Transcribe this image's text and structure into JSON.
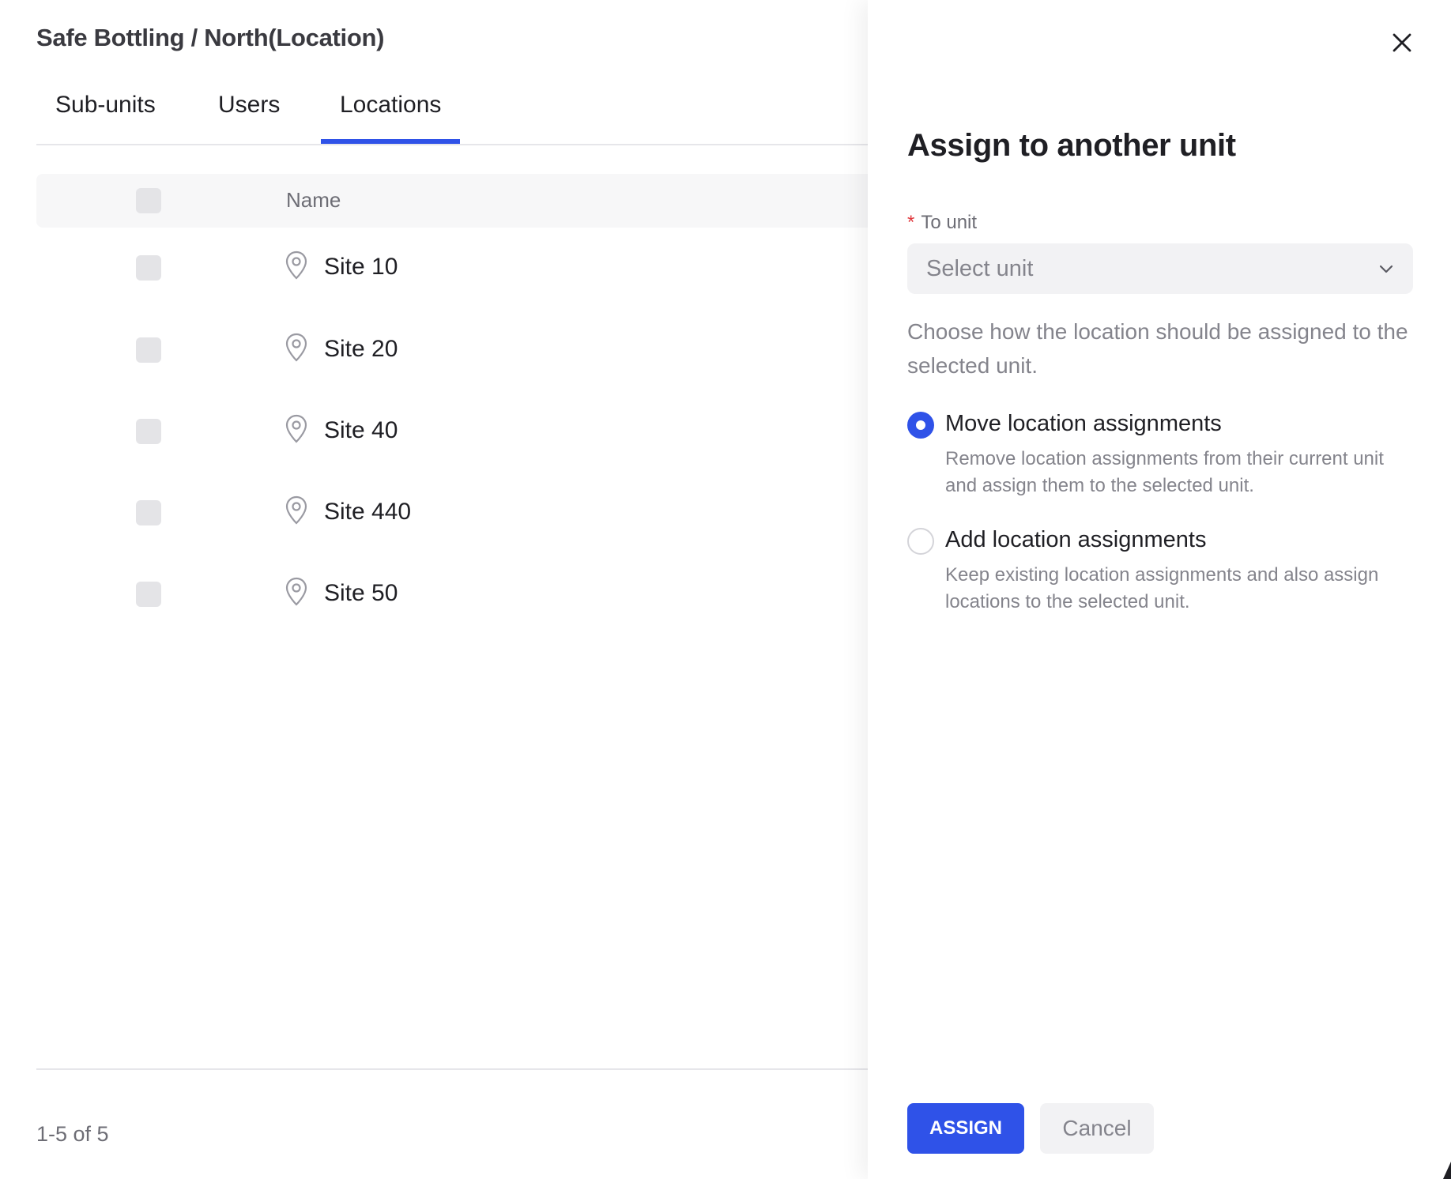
{
  "page": {
    "breadcrumb": "Safe Bottling / North(Location)",
    "tabs": [
      {
        "label": "Sub-units",
        "active": false
      },
      {
        "label": "Users",
        "active": false
      },
      {
        "label": "Locations",
        "active": true
      }
    ],
    "table": {
      "columns": [
        "Name"
      ],
      "rows": [
        {
          "name": "Site 10",
          "icon": "map-pin-icon"
        },
        {
          "name": "Site 20",
          "icon": "map-pin-icon"
        },
        {
          "name": "Site 40",
          "icon": "map-pin-icon"
        },
        {
          "name": "Site 440",
          "icon": "map-pin-icon"
        },
        {
          "name": "Site 50",
          "icon": "map-pin-icon"
        }
      ]
    },
    "pagination": "1-5 of 5"
  },
  "drawer": {
    "title": "Assign to another unit",
    "close_icon": "close-icon",
    "field": {
      "required_marker": "*",
      "label": "To unit",
      "placeholder": "Select unit",
      "icon": "chevron-down-icon"
    },
    "helper": "Choose how the location should be assigned to the selected unit.",
    "options": [
      {
        "title": "Move location assignments",
        "description": "Remove location assignments from their current unit and assign them to the selected unit.",
        "selected": true
      },
      {
        "title": "Add location assignments",
        "description": "Keep existing location assignments and also assign locations to the selected unit.",
        "selected": false
      }
    ],
    "buttons": {
      "assign": "ASSIGN",
      "cancel": "Cancel"
    }
  },
  "colors": {
    "accent": "#2f52e8",
    "required": "#e0393e",
    "muted_text": "#84848c",
    "checkbox": "#e4e4e7"
  }
}
